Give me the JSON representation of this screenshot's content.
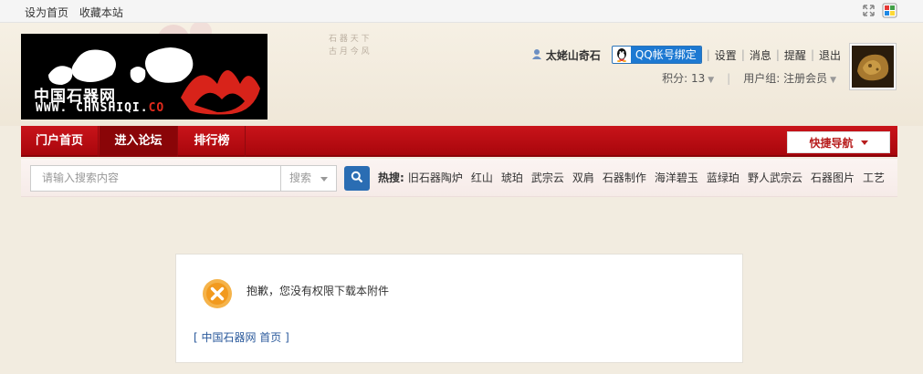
{
  "topbar": {
    "set_home": "设为首页",
    "bookmark": "收藏本站",
    "icons": [
      "expand-icon",
      "color-scheme-icon"
    ]
  },
  "logo": {
    "cn_text": "中国石器网",
    "en_text": "WWW. CHNSHIQI.",
    "en_suffix": "CO"
  },
  "user": {
    "username": "太姥山奇石",
    "qq_bind": "QQ帐号绑定",
    "links": [
      "设置",
      "消息",
      "提醒",
      "退出"
    ],
    "points_label": "积分: 13",
    "group_label": "用户组: 注册会员"
  },
  "nav": {
    "items": [
      "门户首页",
      "进入论坛",
      "排行榜"
    ],
    "active_index": 1,
    "quick_nav": "快捷导航"
  },
  "search": {
    "placeholder": "请输入搜索内容",
    "type": "搜索",
    "hot_label": "热搜:",
    "hot_keywords": [
      "旧石器陶炉",
      "红山",
      "琥珀",
      "武宗云",
      "双肩",
      "石器制作",
      "海洋碧玉",
      "蓝绿珀",
      "野人武宗云",
      "石器图片",
      "工艺"
    ]
  },
  "message": {
    "text": "抱歉，您没有权限下载本附件",
    "home_link": "[ 中国石器网 首页 ]"
  },
  "colors": {
    "nav_red": "#c9141a",
    "nav_active": "#8a0508",
    "search_blue": "#2a6db3",
    "qq_blue": "#1d79d2",
    "error_orange": "#f29a1e"
  }
}
